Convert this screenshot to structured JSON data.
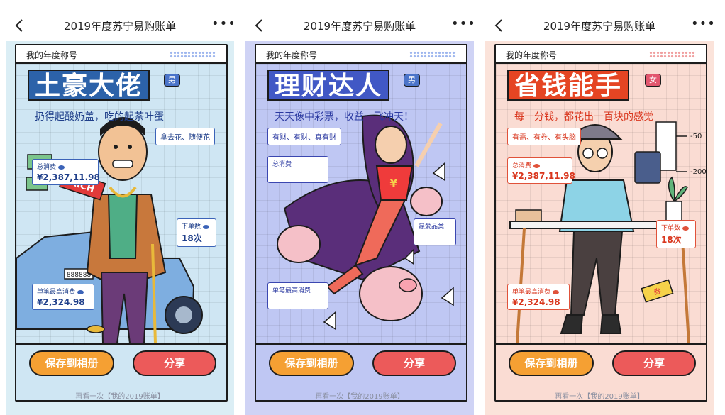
{
  "panels": [
    {
      "nav": {
        "title": "2019年度苏宁易购账单"
      },
      "card": {
        "header": "我的年度称号",
        "title": "土豪大佬",
        "gender": "男",
        "subtitle": "扔得起酸奶盖，吃的起茶叶蛋",
        "tags": [
          "拿去花、随便花"
        ],
        "plate": "888888",
        "rich": "RICH",
        "stats": [
          {
            "label": "总消费",
            "value": "¥2,387,11.98"
          },
          {
            "label": "下单数",
            "value": "18次"
          },
          {
            "label": "单笔最高消费",
            "value": "¥2,324.98"
          }
        ],
        "save_label": "保存到相册",
        "share_label": "分享",
        "footer": "再看一次【我的2019账单】"
      }
    },
    {
      "nav": {
        "title": "2019年度苏宁易购账单"
      },
      "card": {
        "header": "我的年度称号",
        "title": "理财达人",
        "gender": "男",
        "subtitle": "天天像中彩票，收益一飞冲天！",
        "tags": [
          "有财、有财、真有财"
        ],
        "stats": [
          {
            "label": "总消费",
            "value": ""
          },
          {
            "label": "最爱品类",
            "value": ""
          },
          {
            "label": "单笔最高消费",
            "value": ""
          }
        ],
        "save_label": "保存到相册",
        "share_label": "分享",
        "footer": "再看一次【我的2019账单】"
      }
    },
    {
      "nav": {
        "title": "2019年度苏宁易购账单"
      },
      "card": {
        "header": "我的年度称号",
        "title": "省钱能手",
        "gender": "女",
        "subtitle": "每一分钱，都花出一百块的感觉",
        "tags": [
          "有需、有券、有头脑"
        ],
        "marks": [
          "-50",
          "-200"
        ],
        "coupon": "券",
        "stats": [
          {
            "label": "总消费",
            "value": "¥2,387,11.98"
          },
          {
            "label": "下单数",
            "value": "18次"
          },
          {
            "label": "单笔最高消费",
            "value": "¥2,324.98"
          }
        ],
        "save_label": "保存到相册",
        "share_label": "分享",
        "footer": "再看一次【我的2019账单】"
      }
    }
  ],
  "icons": {
    "back": "chevron-left-icon",
    "more": "more-dots-icon",
    "gender_male": "male-icon",
    "gender_female": "female-icon",
    "eye": "eye-icon"
  },
  "colors": {
    "blue_bg": "#cfe6f3",
    "purple_bg": "#bfc7f3",
    "pink_bg": "#fadcd3",
    "save_btn": "#f5a033",
    "share_btn": "#ec5a5a"
  }
}
